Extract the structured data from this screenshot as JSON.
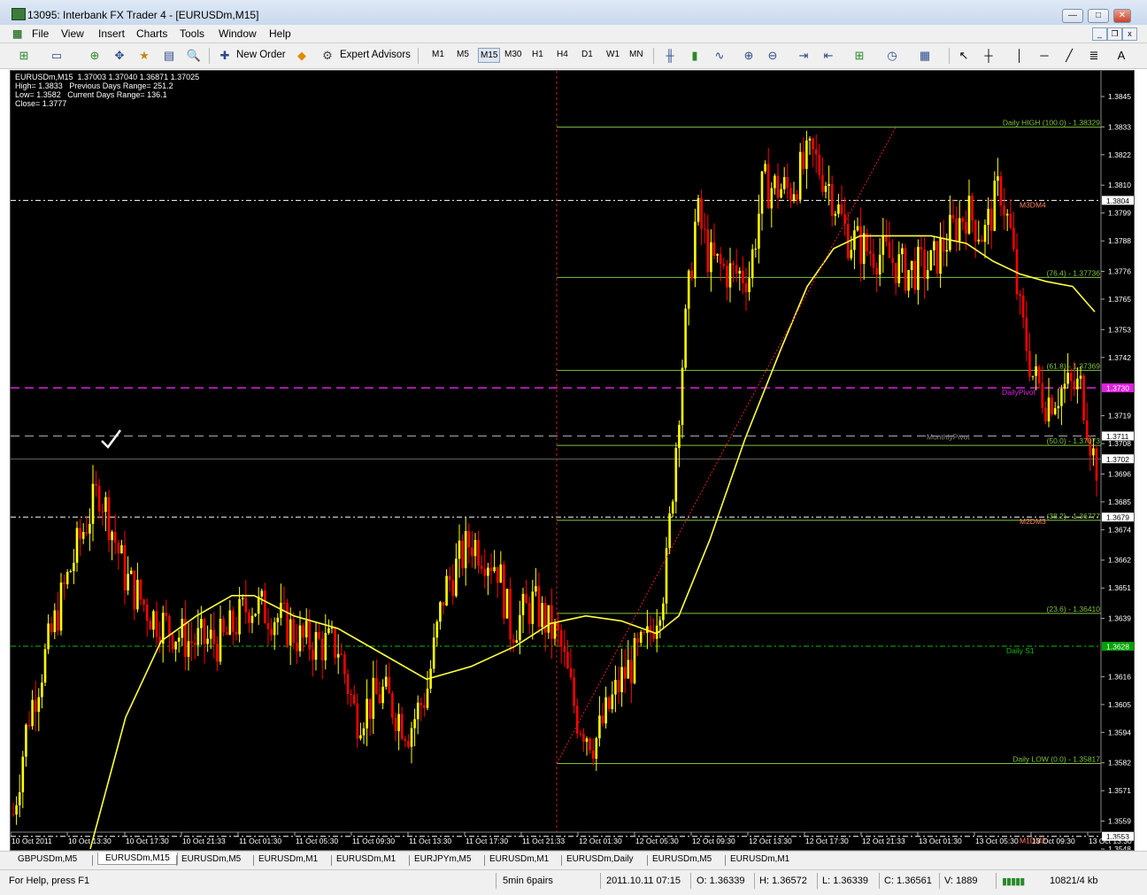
{
  "window": {
    "title": "13095: Interbank FX Trader 4 - [EURUSDm,M15]"
  },
  "menu": [
    "File",
    "View",
    "Insert",
    "Charts",
    "Tools",
    "Window",
    "Help"
  ],
  "toolbar": {
    "new_order": "New Order",
    "expert_advisors": "Expert Advisors",
    "timeframes": [
      "M1",
      "M5",
      "M15",
      "M30",
      "H1",
      "H4",
      "D1",
      "W1",
      "MN"
    ],
    "active_timeframe": "M15"
  },
  "chart": {
    "info_lines": [
      "EURUSDm,M15  1.37003 1.37040 1.36871 1.37025",
      "High= 1.3833   Previous Days Range= 251.2",
      "Low= 1.3582   Current Days Range= 136.1",
      "Close= 1.3777"
    ],
    "price_ticks": [
      "1.3845",
      "1.3833",
      "1.3822",
      "1.3810",
      "1.3799",
      "1.3788",
      "1.3776",
      "1.3765",
      "1.3753",
      "1.3742",
      "1.3719",
      "1.3708",
      "1.3696",
      "1.3685",
      "1.3674",
      "1.3662",
      "1.3651",
      "1.3639",
      "1.3616",
      "1.3605",
      "1.3594",
      "1.3582",
      "1.3571",
      "1.3559",
      "1.3548"
    ],
    "price_labels": [
      {
        "text": "1.3804",
        "bg": "#ffffff",
        "fg": "#000000"
      },
      {
        "text": "1.3730",
        "bg": "#e020e0",
        "fg": "#ffffff"
      },
      {
        "text": "1.3711",
        "bg": "#ffffff",
        "fg": "#000000"
      },
      {
        "text": "1.3702",
        "bg": "#ffffff",
        "fg": "#000000"
      },
      {
        "text": "1.3679",
        "bg": "#ffffff",
        "fg": "#000000"
      },
      {
        "text": "1.3628",
        "bg": "#00a000",
        "fg": "#ffffff"
      },
      {
        "text": "1.3553",
        "bg": "#ffffff",
        "fg": "#000000"
      }
    ],
    "time_labels": [
      "10 Oct 2011",
      "10 Oct 13:30",
      "10 Oct 17:30",
      "10 Oct 21:33",
      "11 Oct 01:30",
      "11 Oct 05:30",
      "11 Oct 09:30",
      "11 Oct 13:30",
      "11 Oct 17:30",
      "11 Oct 21:33",
      "12 Oct 01:30",
      "12 Oct 05:30",
      "12 Oct 09:30",
      "12 Oct 13:30",
      "12 Oct 17:30",
      "12 Oct 21:33",
      "13 Oct 01:30",
      "13 Oct 05:30",
      "13 Oct 09:30",
      "13 Oct 13:30"
    ],
    "fib_labels": [
      "Daily HIGH (100.0) -  1.38329",
      "(76.4) -  1.37736",
      "(61.8) -  1.37369",
      "(50.0) -  1.37073",
      "(38.2) -  1.36777",
      "(23.6) -  1.36410",
      "Daily LOW (0.0) -  1.35817"
    ],
    "level_labels": [
      "M3DM4",
      "DailyPivot",
      "MonthlyPivot",
      "M2DM3",
      "Daily S1",
      "M1DM2"
    ],
    "colors": {
      "bull": "#ffff00",
      "bear": "#ff0000",
      "ma": "#ffff40",
      "fib": "#7fc23e",
      "pivot": "#e020e0"
    }
  },
  "chart_tabs": [
    "GBPUSDm,M5",
    "EURUSDm,M15",
    "EURUSDm,M5",
    "EURUSDm,M1",
    "EURUSDm,M1",
    "EURJPYm,M5",
    "EURUSDm,M1",
    "EURUSDm,Daily",
    "EURUSDm,M5",
    "EURUSDm,M1"
  ],
  "active_tab": "EURUSDm,M15",
  "status": {
    "help": "For Help, press F1",
    "profile": "5min 6pairs",
    "datetime": "2011.10.11 07:15",
    "open": "O: 1.36339",
    "high": "H: 1.36572",
    "low": "L: 1.36339",
    "close": "C: 1.36561",
    "volume": "V: 1889",
    "traffic": "10821/4 kb"
  }
}
